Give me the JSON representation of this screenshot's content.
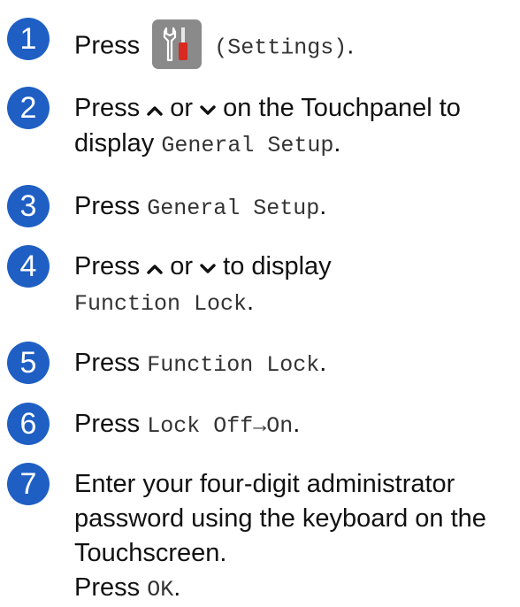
{
  "accent_color": "#1f5fc4",
  "steps": [
    {
      "num": "1",
      "t1": "Press ",
      "t2": " ",
      "icon_name": "settings-icon",
      "mono": "(Settings)",
      "t3": "."
    },
    {
      "num": "2",
      "a": "Press ",
      "b": " or ",
      "c": " on the Touchpanel to",
      "d": "display ",
      "mono": "General Setup",
      "e": "."
    },
    {
      "num": "3",
      "a": "Press ",
      "mono": "General Setup",
      "b": "."
    },
    {
      "num": "4",
      "a": "Press ",
      "b": " or ",
      "c": " to display",
      "mono": "Function Lock",
      "d": "."
    },
    {
      "num": "5",
      "a": "Press ",
      "mono": "Function Lock",
      "b": "."
    },
    {
      "num": "6",
      "a": "Press ",
      "mono": "Lock Off→On",
      "b": "."
    },
    {
      "num": "7",
      "l1": "Enter your four-digit administrator",
      "l2": "password using the keyboard on the",
      "l3": "Touchscreen.",
      "a": "Press ",
      "mono": "OK",
      "b": "."
    }
  ]
}
